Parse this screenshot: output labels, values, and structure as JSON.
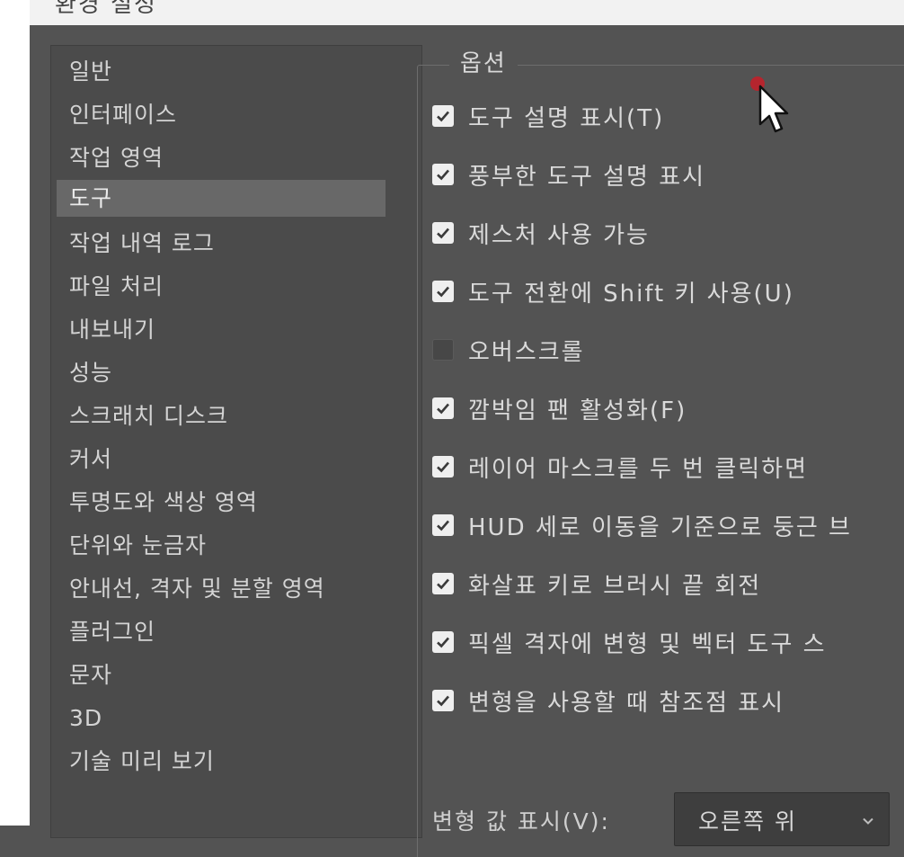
{
  "window": {
    "title": "환경 설정"
  },
  "sidebar": {
    "items": [
      {
        "label": "일반"
      },
      {
        "label": "인터페이스"
      },
      {
        "label": "작업 영역"
      },
      {
        "label": "도구",
        "selected": true
      },
      {
        "label": "작업 내역 로그"
      },
      {
        "label": "파일 처리"
      },
      {
        "label": "내보내기"
      },
      {
        "label": "성능"
      },
      {
        "label": "스크래치 디스크"
      },
      {
        "label": "커서"
      },
      {
        "label": "투명도와 색상 영역"
      },
      {
        "label": "단위와 눈금자"
      },
      {
        "label": "안내선, 격자 및 분할 영역"
      },
      {
        "label": "플러그인"
      },
      {
        "label": "문자"
      },
      {
        "label": "3D"
      },
      {
        "label": "기술 미리 보기"
      }
    ]
  },
  "options": {
    "legend": "옵션",
    "items": [
      {
        "label": "도구 설명 표시(T)",
        "checked": true
      },
      {
        "label": "풍부한 도구 설명 표시",
        "checked": true
      },
      {
        "label": "제스처 사용 가능",
        "checked": true
      },
      {
        "label": "도구 전환에 Shift 키 사용(U)",
        "checked": true
      },
      {
        "label": "오버스크롤",
        "checked": false
      },
      {
        "label": "깜박임 팬 활성화(F)",
        "checked": true
      },
      {
        "label": "레이어 마스크를 두 번 클릭하면 ",
        "checked": true
      },
      {
        "label": "HUD 세로 이동을 기준으로 둥근 브",
        "checked": true
      },
      {
        "label": "화살표 키로 브러시 끝 회전",
        "checked": true
      },
      {
        "label": "픽셀 격자에 변형 및 벡터 도구 스",
        "checked": true
      },
      {
        "label": "변형을 사용할 때 참조점 표시",
        "checked": true
      }
    ]
  },
  "transform_values": {
    "label": "변형 값 표시(V):",
    "selected": "오른쪽 위"
  },
  "colors": {
    "dialog_bg": "#535353",
    "sidebar_bg": "#4b4b4b",
    "selected_bg": "#686868",
    "checkbox_bg": "#efefef",
    "cursor_dot": "#c0202a"
  }
}
